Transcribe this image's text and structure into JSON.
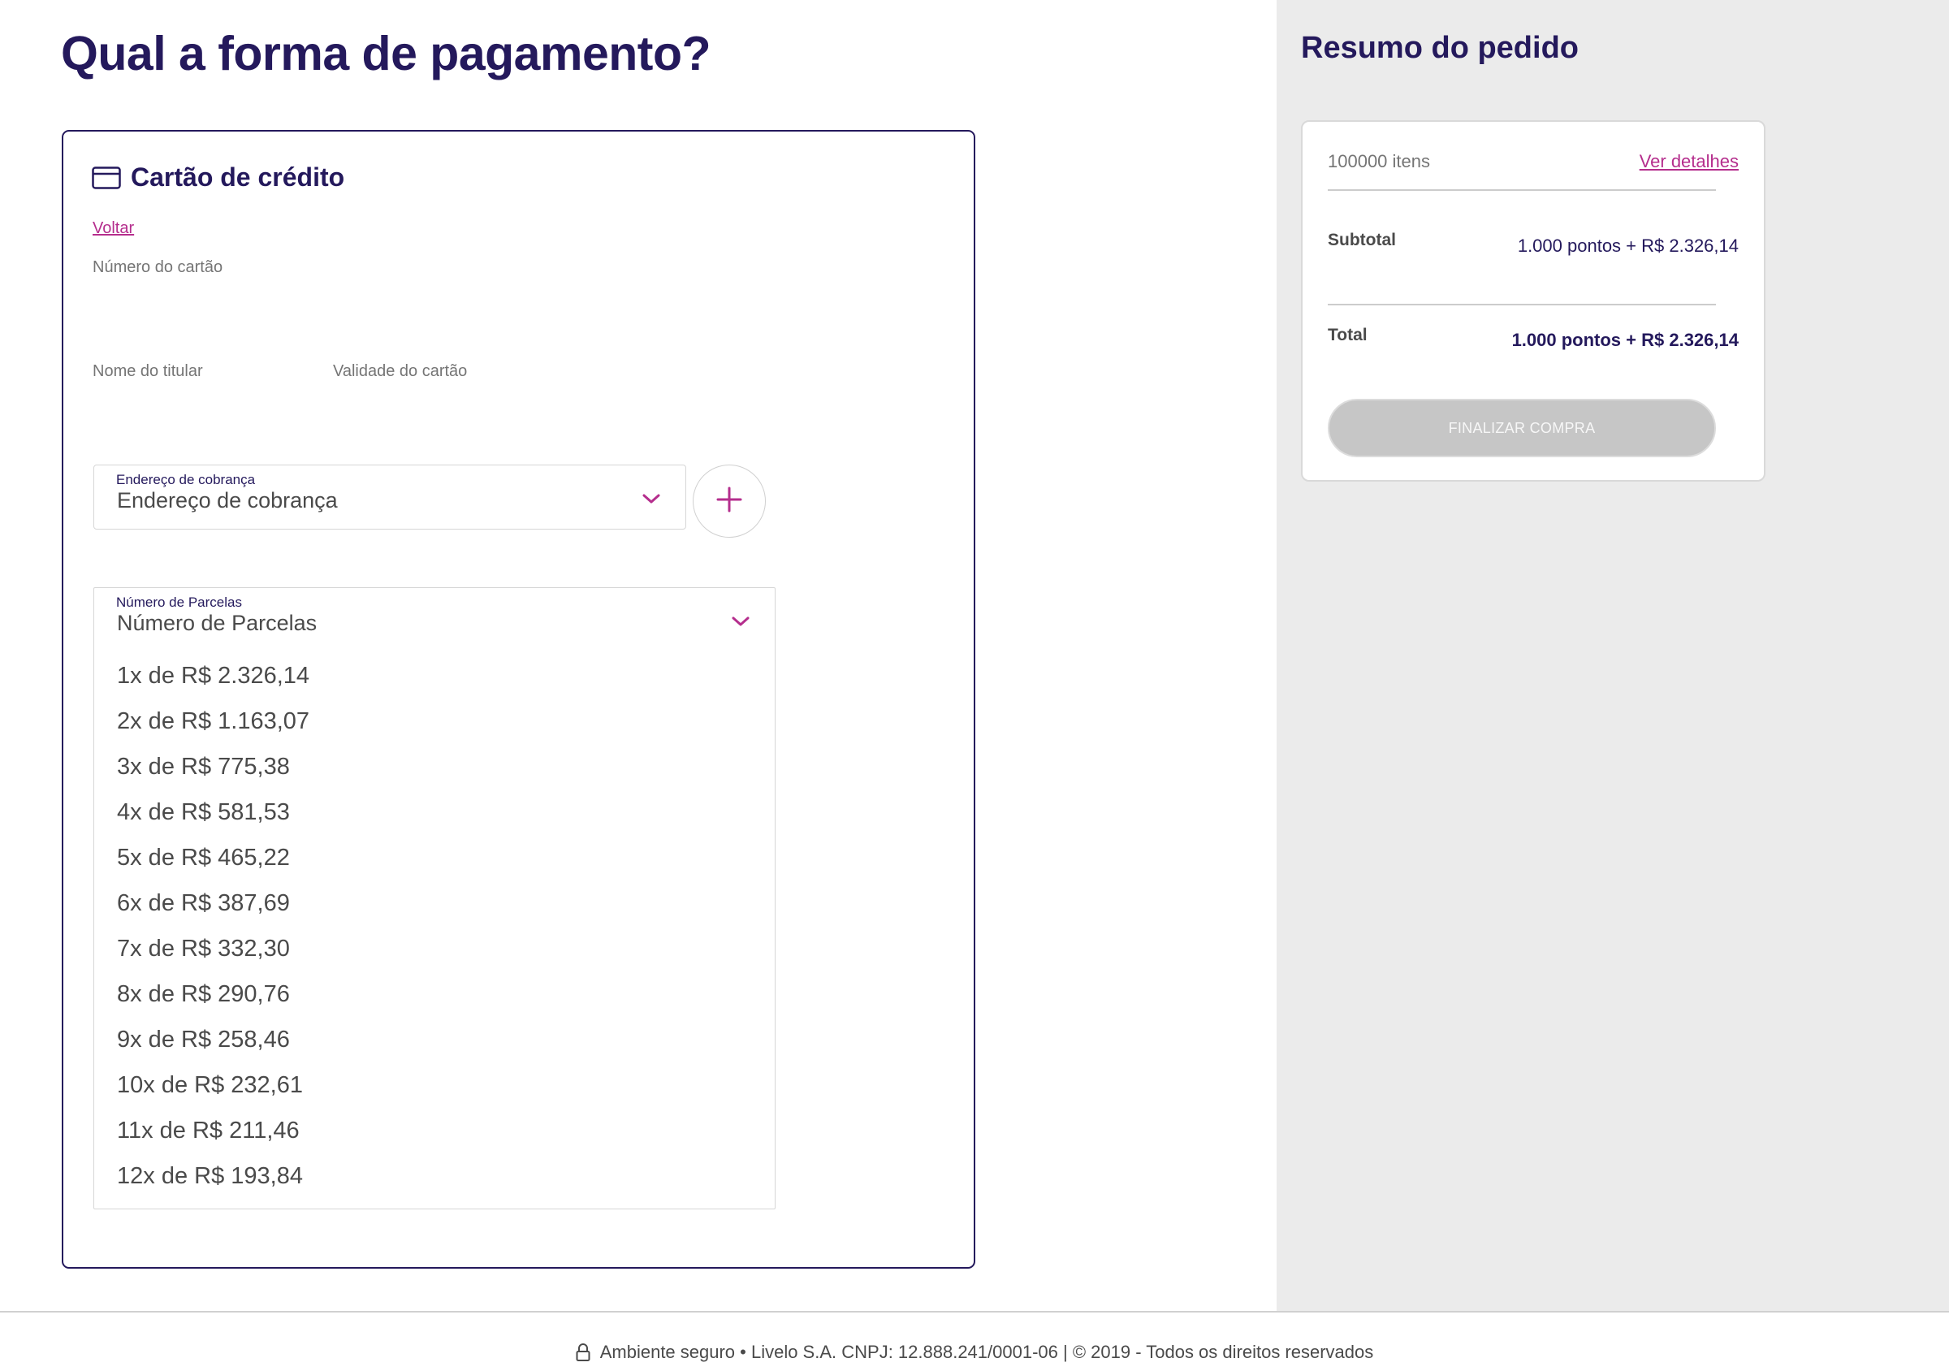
{
  "page": {
    "title": "Qual a forma de pagamento?"
  },
  "payment": {
    "card_title": "Cartão de crédito",
    "card_icon": "credit-card-icon",
    "back_link": "Voltar",
    "card_number_label": "Número do cartão",
    "holder_name_label": "Nome do titular",
    "validity_label": "Validade do cartão",
    "billing_address": {
      "label": "Endereço de cobrança",
      "value": "Endereço de cobrança",
      "add_icon": "plus-icon"
    },
    "installments": {
      "label": "Número de Parcelas",
      "value": "Número de Parcelas",
      "options": [
        "1x de R$ 2.326,14",
        "2x de R$ 1.163,07",
        "3x de R$ 775,38",
        "4x de R$ 581,53",
        "5x de R$ 465,22",
        "6x de R$ 387,69",
        "7x de R$ 332,30",
        "8x de R$ 290,76",
        "9x de R$ 258,46",
        "10x de R$ 232,61",
        "11x de R$ 211,46",
        "12x de R$ 193,84"
      ]
    }
  },
  "summary": {
    "title": "Resumo do pedido",
    "items_count": "100000 itens",
    "details_link": "Ver detalhes",
    "subtotal_label": "Subtotal",
    "subtotal_value": "1.000 pontos + R$ 2.326,14",
    "total_label": "Total",
    "total_value": "1.000 pontos + R$ 2.326,14",
    "finish_button": "FINALIZAR COMPRA"
  },
  "footer": {
    "text": "Ambiente seguro • Livelo S.A. CNPJ: 12.888.241/0001-06 | © 2019 - Todos os direitos reservados",
    "icon": "lock-icon"
  },
  "colors": {
    "brand_navy": "#24195c",
    "accent_magenta": "#b52e8d",
    "disabled_gray": "#c6c6c6",
    "panel_gray": "#ebebeb"
  }
}
